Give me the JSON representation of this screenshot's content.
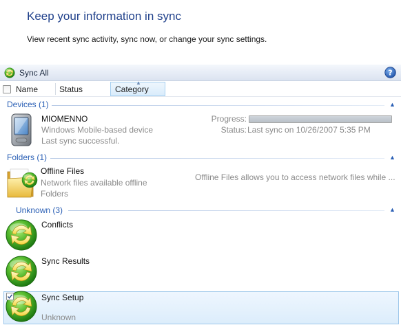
{
  "header": {
    "title": "Keep your information in sync",
    "subtitle": "View recent sync activity, sync now, or change your sync settings."
  },
  "toolbar": {
    "sync_all_label": "Sync All",
    "sync_icon": "sync-arrows-icon",
    "help_icon": "help-icon"
  },
  "columns": [
    {
      "label": "Name"
    },
    {
      "label": "Status"
    },
    {
      "label": "Category",
      "sorted": "ascending"
    }
  ],
  "groups": {
    "devices": {
      "label": "Devices (1)",
      "items": [
        {
          "name": "MIOMENNO",
          "type": "Windows Mobile-based device",
          "status_line": "Last sync successful.",
          "progress_label": "Progress:",
          "progress_value": 1.0,
          "status_label": "Status:",
          "status_value": "Last sync on 10/26/2007 5:35 PM",
          "icon": "pda-device-icon"
        }
      ]
    },
    "folders": {
      "label": "Folders (1)",
      "items": [
        {
          "name": "Offline Files",
          "desc": "Network files available offline",
          "category": "Folders",
          "status": "Offline Files allows you to access network files while ...",
          "icon": "sync-folder-icon"
        }
      ]
    },
    "unknown": {
      "label": "Unknown (3)",
      "items": [
        {
          "name": "Conflicts",
          "icon": "sync-center-icon"
        },
        {
          "name": "Sync Results",
          "icon": "sync-center-icon"
        },
        {
          "name": "Sync Setup",
          "category": "Unknown",
          "icon": "sync-center-icon",
          "checked": true,
          "selected": true
        }
      ]
    }
  },
  "colors": {
    "title": "#1e3f8a",
    "group_header": "#2a5fb5",
    "muted_text": "#8a8a8a",
    "selection": "#dcedfb"
  }
}
